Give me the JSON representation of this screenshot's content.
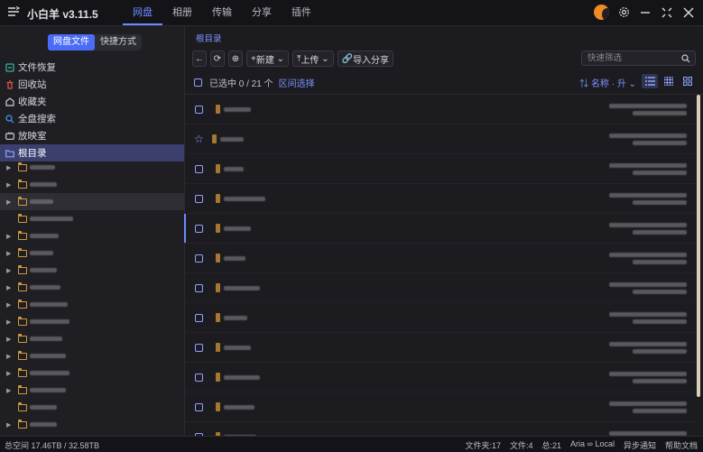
{
  "app": {
    "title": "小白羊 v3.11.5"
  },
  "tabs": [
    {
      "label": "网盘",
      "active": true
    },
    {
      "label": "相册",
      "active": false
    },
    {
      "label": "传输",
      "active": false
    },
    {
      "label": "分享",
      "active": false
    },
    {
      "label": "插件",
      "active": false
    }
  ],
  "sidebar": {
    "segments": [
      {
        "label": "网盘文件",
        "active": true
      },
      {
        "label": "快捷方式",
        "active": false
      }
    ],
    "items": [
      {
        "label": "文件恢复",
        "icon": "recovery-icon",
        "color": "#37b09a"
      },
      {
        "label": "回收站",
        "icon": "trash-icon",
        "color": "#e0534f"
      },
      {
        "label": "收藏夹",
        "icon": "favorite-icon",
        "color": "#cfcfd6"
      },
      {
        "label": "全盘搜索",
        "icon": "search-icon",
        "color": "#4a8df0"
      },
      {
        "label": "放映室",
        "icon": "tv-icon",
        "color": "#cfcfd6"
      },
      {
        "label": "根目录",
        "icon": "folder-icon",
        "color": "#8fa4ff"
      }
    ]
  },
  "main": {
    "breadcrumb": "根目录",
    "toolbar": {
      "new_label": "新建",
      "upload_label": "上传",
      "import_label": "导入分享"
    },
    "filter_placeholder": "快速筛选",
    "selection": {
      "text": "已选中 0 / 21 个",
      "range_label": "区间选择"
    },
    "sort_label": "名称 · 升"
  },
  "status": {
    "left": "总空间 17.46TB / 32.58TB",
    "right": [
      "文件夹:17",
      "文件:4",
      "总:21",
      "Aria ∞ Local",
      "异步通知",
      "帮助文档"
    ]
  },
  "colors": {
    "accent": "#6b8cff",
    "folder": "#d29b3a",
    "background": "#1b1b20"
  }
}
